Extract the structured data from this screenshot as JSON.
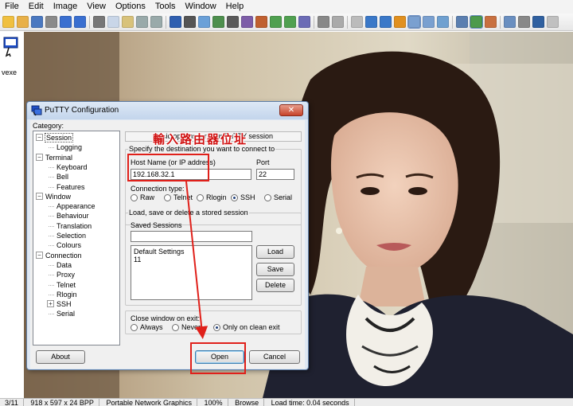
{
  "menubar": {
    "items": [
      "File",
      "Edit",
      "Image",
      "View",
      "Options",
      "Tools",
      "Window",
      "Help"
    ]
  },
  "viewer": {
    "file_label": "vexe",
    "status": {
      "index": "3/11",
      "dimensions": "918 x 597 x 24 BPP",
      "format": "Portable Network Graphics",
      "zoom": "100%",
      "mode": "Browse",
      "load_time": "Load time: 0.04 seconds"
    }
  },
  "putty": {
    "title": "PuTTY Configuration",
    "close_glyph": "✕",
    "category_label": "Category:",
    "tree": [
      {
        "label": "Session",
        "level": 0,
        "expander": "−",
        "selected": true
      },
      {
        "label": "Logging",
        "level": 1
      },
      {
        "label": "Terminal",
        "level": 0,
        "expander": "−"
      },
      {
        "label": "Keyboard",
        "level": 1
      },
      {
        "label": "Bell",
        "level": 1
      },
      {
        "label": "Features",
        "level": 1
      },
      {
        "label": "Window",
        "level": 0,
        "expander": "−"
      },
      {
        "label": "Appearance",
        "level": 1
      },
      {
        "label": "Behaviour",
        "level": 1
      },
      {
        "label": "Translation",
        "level": 1
      },
      {
        "label": "Selection",
        "level": 1
      },
      {
        "label": "Colours",
        "level": 1
      },
      {
        "label": "Connection",
        "level": 0,
        "expander": "−"
      },
      {
        "label": "Data",
        "level": 1
      },
      {
        "label": "Proxy",
        "level": 1
      },
      {
        "label": "Telnet",
        "level": 1
      },
      {
        "label": "Rlogin",
        "level": 1
      },
      {
        "label": "SSH",
        "level": 1,
        "expander": "+"
      },
      {
        "label": "Serial",
        "level": 1
      }
    ],
    "panel_header": "Basic options for your PuTTY session",
    "destination_title": "Specify the destination you want to connect to",
    "host_label": "Host Name (or IP address)",
    "host_value": "192.168.32.1",
    "port_label": "Port",
    "port_value": "22",
    "conn_type_label": "Connection type:",
    "conn_types": [
      {
        "label": "Raw",
        "checked": false
      },
      {
        "label": "Telnet",
        "checked": false
      },
      {
        "label": "Rlogin",
        "checked": false
      },
      {
        "label": "SSH",
        "checked": true
      },
      {
        "label": "Serial",
        "checked": false
      }
    ],
    "sessions_title": "Load, save or delete a stored session",
    "saved_sessions_label": "Saved Sessions",
    "saved_sessions_value": "",
    "sessions": [
      "Default Settings",
      "11"
    ],
    "load_label": "Load",
    "save_label": "Save",
    "delete_label": "Delete",
    "close_window_label": "Close window on exit:",
    "close_options": [
      {
        "label": "Always",
        "checked": false
      },
      {
        "label": "Never",
        "checked": false
      },
      {
        "label": "Only on clean exit",
        "checked": true
      }
    ],
    "about_label": "About",
    "open_label": "Open",
    "cancel_label": "Cancel"
  },
  "annotation": {
    "text": "輸入路由器位址",
    "color": "#e0201a"
  }
}
